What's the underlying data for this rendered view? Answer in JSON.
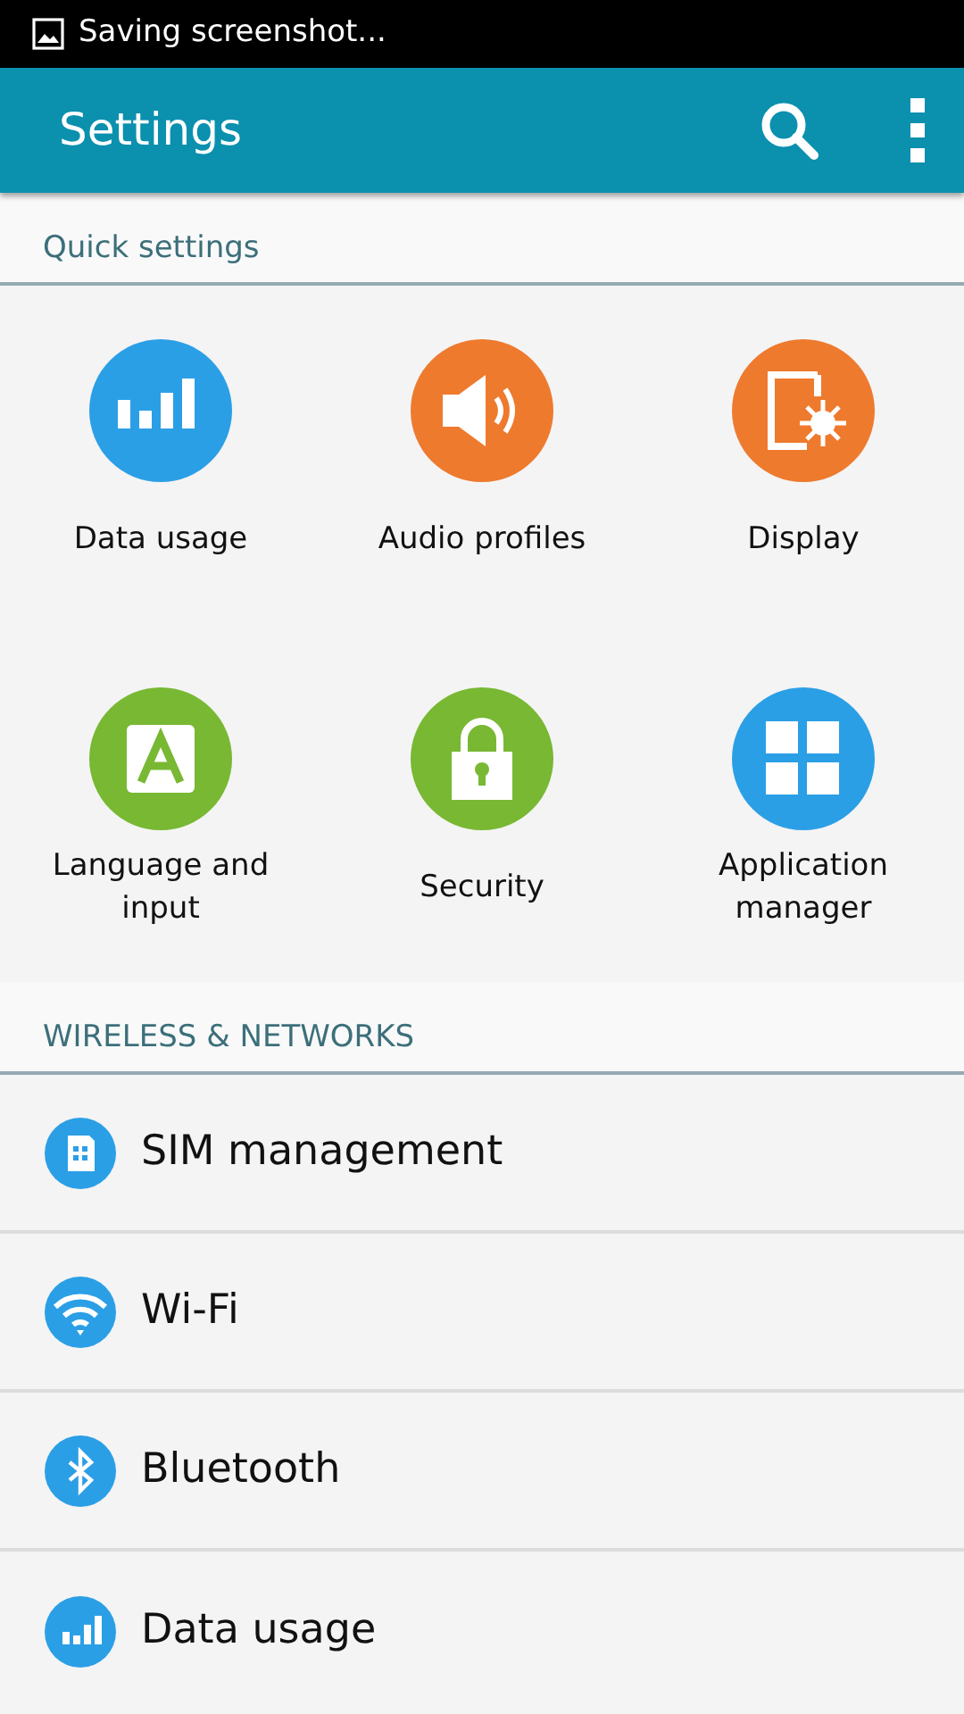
{
  "status_bar": {
    "notification": "Saving screenshot..."
  },
  "app_bar": {
    "title": "Settings"
  },
  "quick_settings": {
    "header": "Quick settings",
    "tiles": [
      {
        "label": "Data usage",
        "kind": "bars",
        "color": "#2b9fe6"
      },
      {
        "label": "Audio profiles",
        "kind": "speaker",
        "color": "#ee7a2e"
      },
      {
        "label": "Display",
        "kind": "display",
        "color": "#ee7a2e"
      },
      {
        "label": "Language and input",
        "kind": "letter",
        "color": "#78b833"
      },
      {
        "label": "Security",
        "kind": "lock",
        "color": "#78b833"
      },
      {
        "label": "Application manager",
        "kind": "grid",
        "color": "#2b9fe6"
      }
    ]
  },
  "wireless_networks": {
    "header": "WIRELESS & NETWORKS",
    "items": [
      {
        "label": "SIM management",
        "kind": "sim"
      },
      {
        "label": "Wi-Fi",
        "kind": "wifi"
      },
      {
        "label": "Bluetooth",
        "kind": "bluetooth"
      },
      {
        "label": "Data usage",
        "kind": "bars"
      }
    ]
  }
}
